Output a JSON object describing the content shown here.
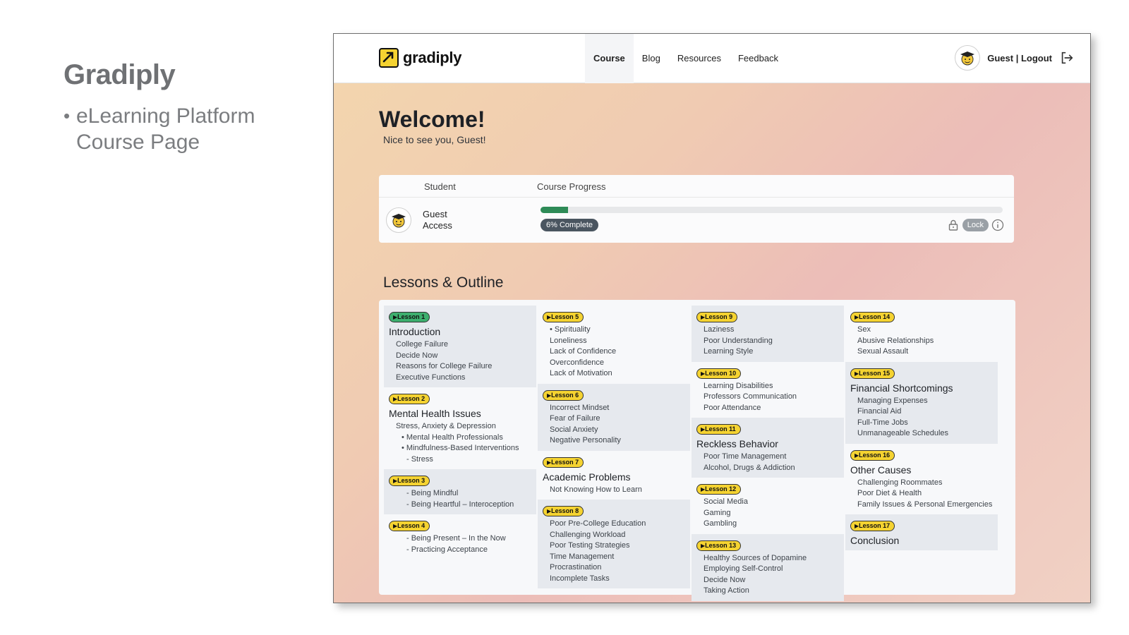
{
  "slide": {
    "title": "Gradiply",
    "bullet": "eLearning Platform Course Page"
  },
  "nav": {
    "brand": "gradiply",
    "links": [
      "Course",
      "Blog",
      "Resources",
      "Feedback"
    ],
    "active_link": "Course",
    "user_label": "Guest | Logout"
  },
  "welcome": {
    "title": "Welcome!",
    "subtitle": "Nice to see you, Guest!"
  },
  "progress": {
    "col_student": "Student",
    "col_progress": "Course Progress",
    "student_name_line1": "Guest",
    "student_name_line2": "Access",
    "percent": 6,
    "percent_label": "6% Complete",
    "lock_label": "Lock"
  },
  "lessons": {
    "title": "Lessons & Outline",
    "columns": [
      [
        {
          "badge": "Lesson 1",
          "active": true,
          "title": "Introduction",
          "items": [
            {
              "t": "College Failure",
              "lvl": 1
            },
            {
              "t": "Decide Now",
              "lvl": 1
            },
            {
              "t": "Reasons for College Failure",
              "lvl": 1
            },
            {
              "t": "Executive Functions",
              "lvl": 1
            }
          ]
        },
        {
          "badge": "Lesson 2",
          "title": "Mental Health Issues",
          "items": [
            {
              "t": "Stress, Anxiety & Depression",
              "lvl": 1
            },
            {
              "t": "• Mental Health Professionals",
              "lvl": 2
            },
            {
              "t": "• Mindfulness-Based Interventions",
              "lvl": 2
            },
            {
              "t": "- Stress",
              "lvl": 3
            }
          ]
        },
        {
          "badge": "Lesson 3",
          "title": "",
          "items": [
            {
              "t": "- Being Mindful",
              "lvl": 3
            },
            {
              "t": "- Being Heartful – Interoception",
              "lvl": 3
            }
          ]
        },
        {
          "badge": "Lesson 4",
          "title": "",
          "items": [
            {
              "t": "- Being Present – In the Now",
              "lvl": 3
            },
            {
              "t": "- Practicing Acceptance",
              "lvl": 3
            }
          ]
        }
      ],
      [
        {
          "badge": "Lesson 5",
          "title": "",
          "items": [
            {
              "t": "• Spirituality",
              "lvl": 1
            },
            {
              "t": "Loneliness",
              "lvl": 1
            },
            {
              "t": "Lack of Confidence",
              "lvl": 1
            },
            {
              "t": "Overconfidence",
              "lvl": 1
            },
            {
              "t": "Lack of Motivation",
              "lvl": 1
            }
          ]
        },
        {
          "badge": "Lesson 6",
          "title": "",
          "items": [
            {
              "t": "Incorrect Mindset",
              "lvl": 1
            },
            {
              "t": "Fear of Failure",
              "lvl": 1
            },
            {
              "t": "Social Anxiety",
              "lvl": 1
            },
            {
              "t": "Negative Personality",
              "lvl": 1
            }
          ]
        },
        {
          "badge": "Lesson 7",
          "title": "Academic Problems",
          "items": [
            {
              "t": "Not Knowing How to Learn",
              "lvl": 1
            }
          ]
        },
        {
          "badge": "Lesson 8",
          "title": "",
          "items": [
            {
              "t": "Poor Pre-College Education",
              "lvl": 1
            },
            {
              "t": "Challenging Workload",
              "lvl": 1
            },
            {
              "t": "Poor Testing Strategies",
              "lvl": 1
            },
            {
              "t": "Time Management",
              "lvl": 1
            },
            {
              "t": "Procrastination",
              "lvl": 1
            },
            {
              "t": "Incomplete Tasks",
              "lvl": 1
            }
          ]
        }
      ],
      [
        {
          "badge": "Lesson 9",
          "title": "",
          "items": [
            {
              "t": "Laziness",
              "lvl": 1
            },
            {
              "t": "Poor Understanding",
              "lvl": 1
            },
            {
              "t": "Learning Style",
              "lvl": 1
            }
          ]
        },
        {
          "badge": "Lesson 10",
          "title": "",
          "items": [
            {
              "t": "Learning Disabilities",
              "lvl": 1
            },
            {
              "t": "Professors Communication",
              "lvl": 1
            },
            {
              "t": "Poor Attendance",
              "lvl": 1
            }
          ]
        },
        {
          "badge": "Lesson 11",
          "title": "Reckless Behavior",
          "items": [
            {
              "t": "Poor Time Management",
              "lvl": 1
            },
            {
              "t": "Alcohol, Drugs & Addiction",
              "lvl": 1
            }
          ]
        },
        {
          "badge": "Lesson 12",
          "title": "",
          "items": [
            {
              "t": "Social Media",
              "lvl": 1
            },
            {
              "t": "Gaming",
              "lvl": 1
            },
            {
              "t": "Gambling",
              "lvl": 1
            }
          ]
        },
        {
          "badge": "Lesson 13",
          "title": "",
          "items": [
            {
              "t": "Healthy Sources of Dopamine",
              "lvl": 1
            },
            {
              "t": "Employing Self-Control",
              "lvl": 1
            },
            {
              "t": "Decide Now",
              "lvl": 1
            },
            {
              "t": "Taking Action",
              "lvl": 1
            }
          ]
        }
      ],
      [
        {
          "badge": "Lesson 14",
          "title": "",
          "items": [
            {
              "t": "Sex",
              "lvl": 1
            },
            {
              "t": "Abusive Relationships",
              "lvl": 1
            },
            {
              "t": "Sexual Assault",
              "lvl": 1
            }
          ]
        },
        {
          "badge": "Lesson 15",
          "title": "Financial Shortcomings",
          "items": [
            {
              "t": "Managing Expenses",
              "lvl": 1
            },
            {
              "t": "Financial Aid",
              "lvl": 1
            },
            {
              "t": "Full-Time Jobs",
              "lvl": 1
            },
            {
              "t": "Unmanageable Schedules",
              "lvl": 1
            }
          ]
        },
        {
          "badge": "Lesson 16",
          "title": "Other Causes",
          "items": [
            {
              "t": "Challenging Roommates",
              "lvl": 1
            },
            {
              "t": "Poor Diet & Health",
              "lvl": 1
            },
            {
              "t": "Family Issues & Personal Emergencies",
              "lvl": 1
            }
          ]
        },
        {
          "badge": "Lesson 17",
          "title": "Conclusion",
          "items": []
        }
      ]
    ],
    "shaded": [
      [
        0,
        2
      ],
      [
        1,
        3
      ],
      [
        0,
        2,
        4
      ],
      [
        1,
        3
      ]
    ]
  }
}
